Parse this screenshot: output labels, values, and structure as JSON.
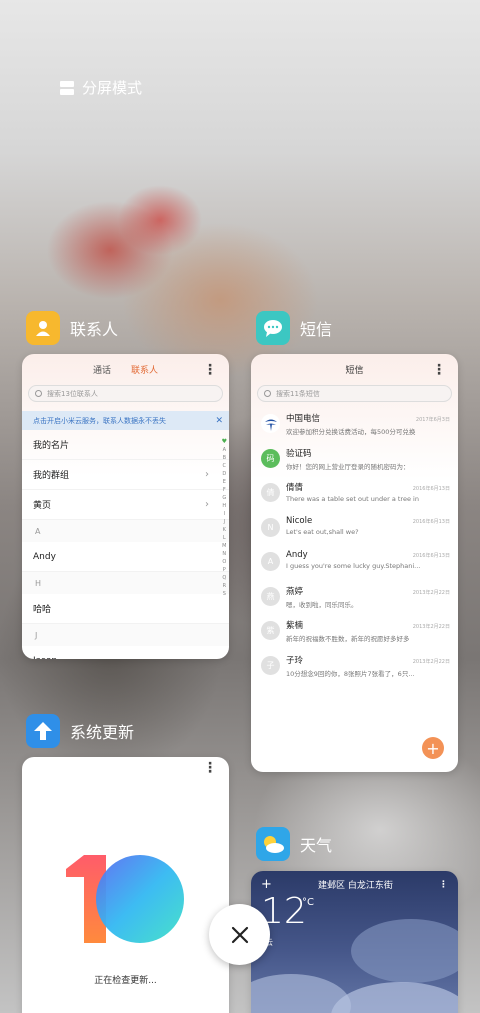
{
  "split_mode": {
    "label": "分屏模式"
  },
  "apps": {
    "contacts": {
      "name": "联系人",
      "tabs": [
        "通话",
        "联系人"
      ],
      "search_placeholder": "搜索13位联系人",
      "banner": "点击开启小米云服务，联系人数据永不丢失",
      "rows": [
        {
          "type": "item",
          "label": "我的名片",
          "chevron": false
        },
        {
          "type": "item",
          "label": "我的群组",
          "chevron": true
        },
        {
          "type": "item",
          "label": "黄页",
          "chevron": true
        },
        {
          "type": "section",
          "label": "A"
        },
        {
          "type": "item",
          "label": "Andy",
          "chevron": false
        },
        {
          "type": "section",
          "label": "H"
        },
        {
          "type": "item",
          "label": "哈哈",
          "chevron": false
        },
        {
          "type": "section",
          "label": "J"
        },
        {
          "type": "item",
          "label": "Jason",
          "chevron": false
        }
      ],
      "alphabet": [
        "♥",
        "A",
        "B",
        "C",
        "D",
        "E",
        "F",
        "G",
        "H",
        "I",
        "J",
        "K",
        "L",
        "M",
        "N",
        "O",
        "P",
        "Q",
        "R",
        "S"
      ]
    },
    "sms": {
      "name": "短信",
      "title": "短信",
      "search_placeholder": "搜索11条短信",
      "messages": [
        {
          "avatar": "",
          "name": "中国电信",
          "date": "2017年6月3日",
          "preview": "欢迎参加积分兑换话费活动，每500分可兑换",
          "avatar_color": "#1f4fa3",
          "avatar_text": ""
        },
        {
          "avatar": "码",
          "name": "验证码",
          "date": "",
          "preview": "你好！您的网上营业厅登录的随机密码为：",
          "avatar_color": "#5cbd5c",
          "avatar_text": "码"
        },
        {
          "avatar": "倩",
          "name": "倩倩",
          "date": "2016年6月13日",
          "preview": "There was a table set out under a tree in",
          "avatar_color": "#e0e0e0",
          "avatar_text": "倩"
        },
        {
          "avatar": "N",
          "name": "Nicole",
          "date": "2016年6月13日",
          "preview": "Let's eat out,shall we?",
          "avatar_color": "#e0e0e0",
          "avatar_text": "N"
        },
        {
          "avatar": "A",
          "name": "Andy",
          "date": "2016年6月13日",
          "preview": "I guess you're some lucky guy.Stephani...",
          "avatar_color": "#e0e0e0",
          "avatar_text": "A"
        },
        {
          "avatar": "燕",
          "name": "燕婷",
          "date": "2013年2月22日",
          "preview": "嗯，收到啦，同乐同乐。",
          "avatar_color": "#e0e0e0",
          "avatar_text": "燕"
        },
        {
          "avatar": "紫",
          "name": "紫楠",
          "date": "2013年2月22日",
          "preview": "新年的祝福数不胜数，新年的祝愿好多好多",
          "avatar_color": "#e0e0e0",
          "avatar_text": "紫"
        },
        {
          "avatar": "子",
          "name": "子玲",
          "date": "2013年2月22日",
          "preview": "10分想念9回的你，8张照片7张看了，6只...",
          "avatar_color": "#e0e0e0",
          "avatar_text": "子"
        }
      ]
    },
    "update": {
      "name": "系统更新",
      "status": "正在检查更新..."
    },
    "weather": {
      "name": "天气",
      "location": "建邺区 白龙江东街",
      "temperature": "12",
      "unit": "°C",
      "condition": "云"
    }
  },
  "colors": {
    "contacts_icon": "#f7b82e",
    "sms_icon": "#3cc7c2",
    "update_icon": "#2f8fe8",
    "weather_icon": "#2fa6e8",
    "accent_orange": "#e36a35"
  }
}
